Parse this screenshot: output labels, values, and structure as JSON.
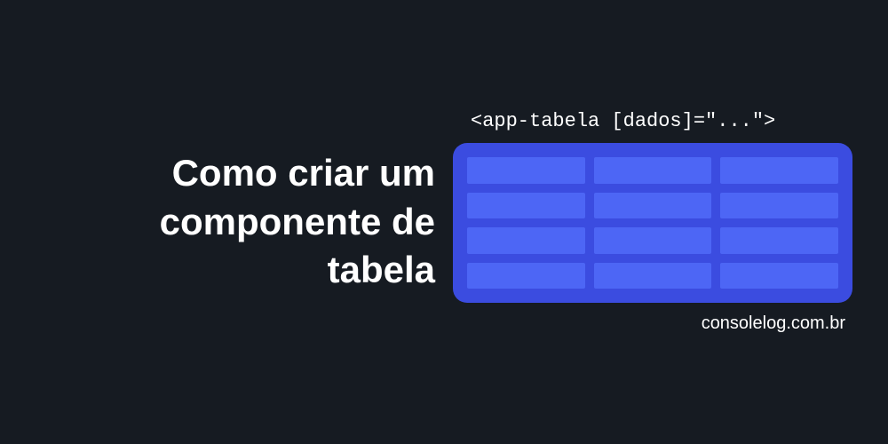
{
  "title": {
    "line1": "Como criar um",
    "line2": "componente de",
    "line3": "tabela"
  },
  "code_snippet": "<app-tabela [dados]=\"...\">",
  "site_credit": "consolelog.com.br"
}
